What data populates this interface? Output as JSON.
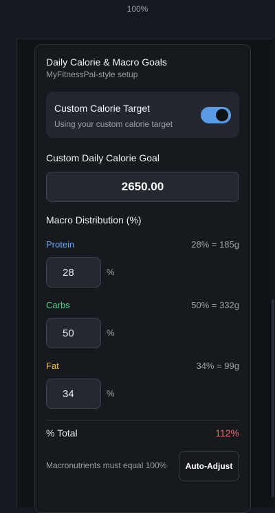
{
  "zoom": "100%",
  "card": {
    "title": "Daily Calorie & Macro Goals",
    "subtitle": "MyFitnessPal-style setup"
  },
  "custom_target": {
    "title": "Custom Calorie Target",
    "description": "Using your custom calorie target",
    "enabled": true
  },
  "calorie_goal": {
    "label": "Custom Daily Calorie Goal",
    "value": "2650.00"
  },
  "macros": {
    "heading": "Macro Distribution (%)",
    "items": [
      {
        "name": "Protein",
        "summary": "28% = 185g",
        "value": "28",
        "unit": "%",
        "color": "#6aa8f0"
      },
      {
        "name": "Carbs",
        "summary": "50% = 332g",
        "value": "50",
        "unit": "%",
        "color": "#4fd18b"
      },
      {
        "name": "Fat",
        "summary": "34% = 99g",
        "value": "34",
        "unit": "%",
        "color": "#f2c14e"
      }
    ]
  },
  "total": {
    "label": "% Total",
    "value": "112%",
    "color": "#f06a6a"
  },
  "footer": {
    "hint": "Macronutrients must equal 100%",
    "auto_adjust_label": "Auto-Adjust"
  }
}
